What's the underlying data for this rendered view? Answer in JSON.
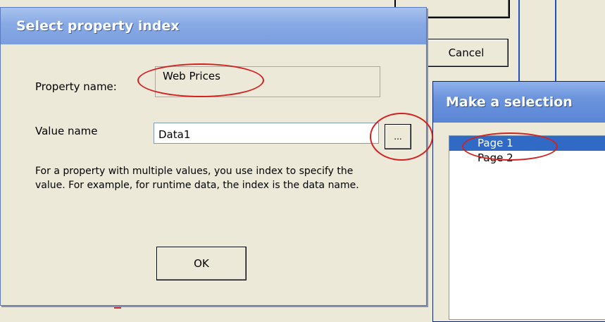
{
  "property_dialog": {
    "title": "Select property index",
    "property_name_label": "Property name:",
    "property_name_value": "Web Prices",
    "value_name_label": "Value name",
    "value_name_value": "Data1",
    "browse_label": "...",
    "help_text": "For a property with multiple values, you use index to specify the value. For example, for runtime data, the index is the data name.",
    "ok_label": "OK"
  },
  "background_window": {
    "cancel_label": "Cancel"
  },
  "selection_dialog": {
    "title": "Make a selection",
    "items": [
      {
        "label": "Page 1",
        "selected": true
      },
      {
        "label": "Page 2",
        "selected": false
      }
    ]
  },
  "colors": {
    "dialog_bg": "#ece9d8",
    "selection_highlight": "#316ac5",
    "annotation": "#d42020"
  }
}
